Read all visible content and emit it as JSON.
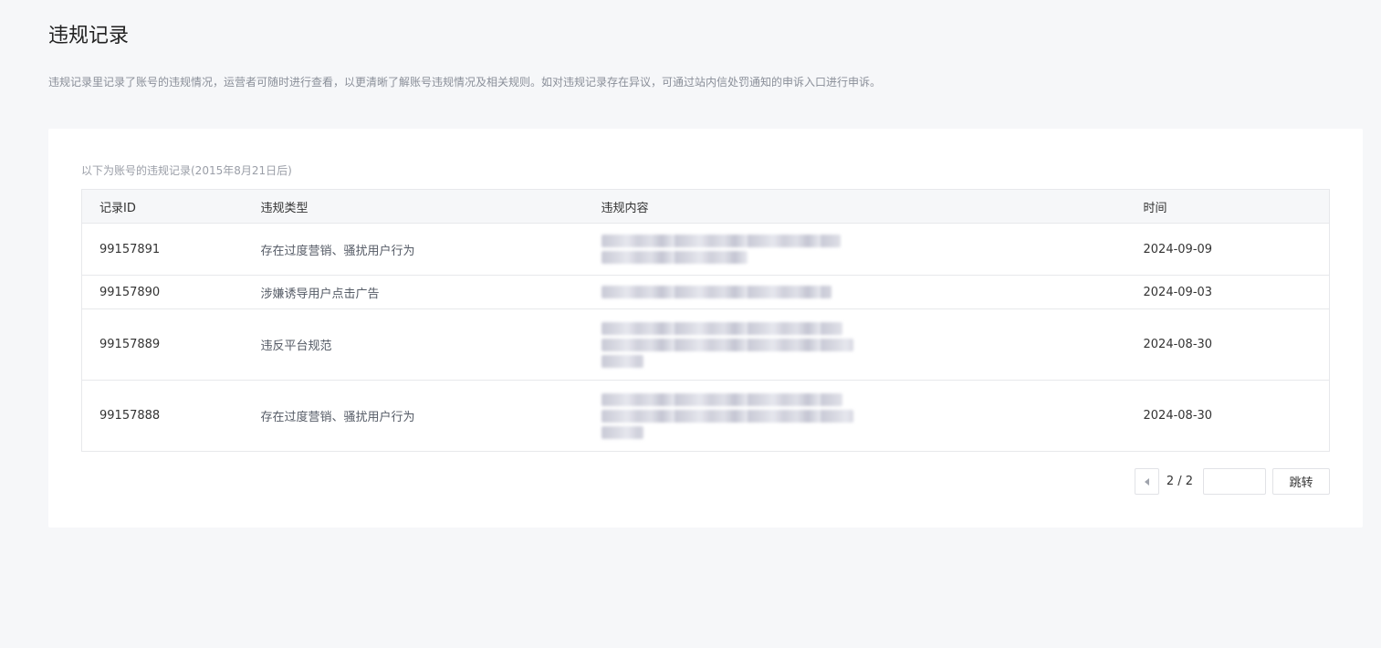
{
  "page": {
    "title": "违规记录",
    "description": "违规记录里记录了账号的违规情况，运营者可随时进行查看，以更清晰了解账号违规情况及相关规则。如对违规记录存在异议，可通过站内信处罚通知的申诉入口进行申诉。"
  },
  "table": {
    "caption": "以下为账号的违规记录(2015年8月21日后)",
    "headers": {
      "id": "记录ID",
      "type": "违规类型",
      "content": "违规内容",
      "time": "时间"
    },
    "rows": [
      {
        "id": "99157891",
        "type": "存在过度营销、骚扰用户行为",
        "time": "2024-09-09",
        "content_lines": 2
      },
      {
        "id": "99157890",
        "type": "涉嫌诱导用户点击广告",
        "time": "2024-09-03",
        "content_lines": 1
      },
      {
        "id": "99157889",
        "type": "违反平台规范",
        "time": "2024-08-30",
        "content_lines": 3
      },
      {
        "id": "99157888",
        "type": "存在过度营销、骚扰用户行为",
        "time": "2024-08-30",
        "content_lines": 2
      }
    ]
  },
  "pager": {
    "info": "2 / 2",
    "input_value": "",
    "jump_label": "跳转",
    "prev_icon": "chevron-left-icon"
  }
}
